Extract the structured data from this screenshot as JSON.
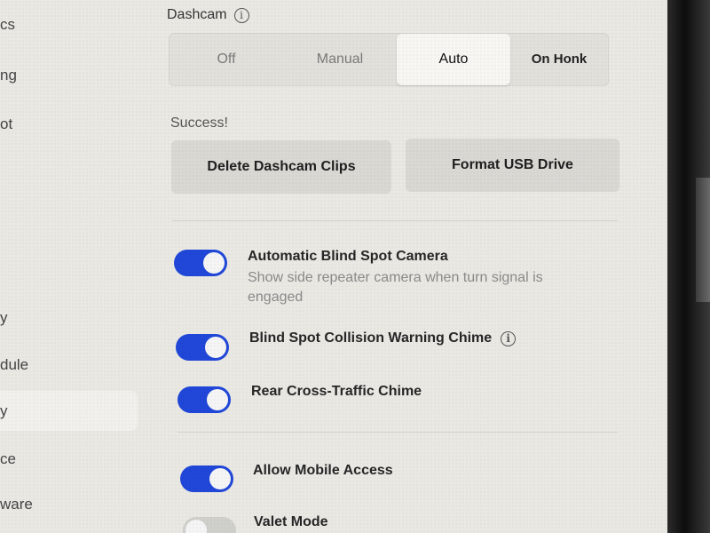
{
  "sidebar": {
    "items": [
      {
        "label": "cs"
      },
      {
        "label": "ng"
      },
      {
        "label": "ot"
      },
      {
        "label": "y"
      },
      {
        "label": "dule"
      },
      {
        "label": "y"
      },
      {
        "label": "ce"
      },
      {
        "label": "ware"
      }
    ]
  },
  "dashcam": {
    "title": "Dashcam",
    "info_icon": "info-icon",
    "options": [
      "Off",
      "Manual",
      "Auto",
      "On Honk"
    ],
    "selected": "Auto",
    "status": "Success!",
    "delete_label": "Delete Dashcam Clips",
    "format_label": "Format USB Drive"
  },
  "settings": [
    {
      "title": "Automatic Blind Spot Camera",
      "subtitle": "Show side repeater camera when turn signal is engaged",
      "enabled": true
    },
    {
      "title": "Blind Spot Collision Warning Chime",
      "info_icon": "info-icon",
      "enabled": true
    },
    {
      "title": "Rear Cross-Traffic Chime",
      "enabled": true
    },
    {
      "title": "Allow Mobile Access",
      "enabled": true
    },
    {
      "title": "Valet Mode",
      "enabled": false
    }
  ],
  "colors": {
    "toggle_on": "#2047d8",
    "background": "#e9e8e3"
  }
}
